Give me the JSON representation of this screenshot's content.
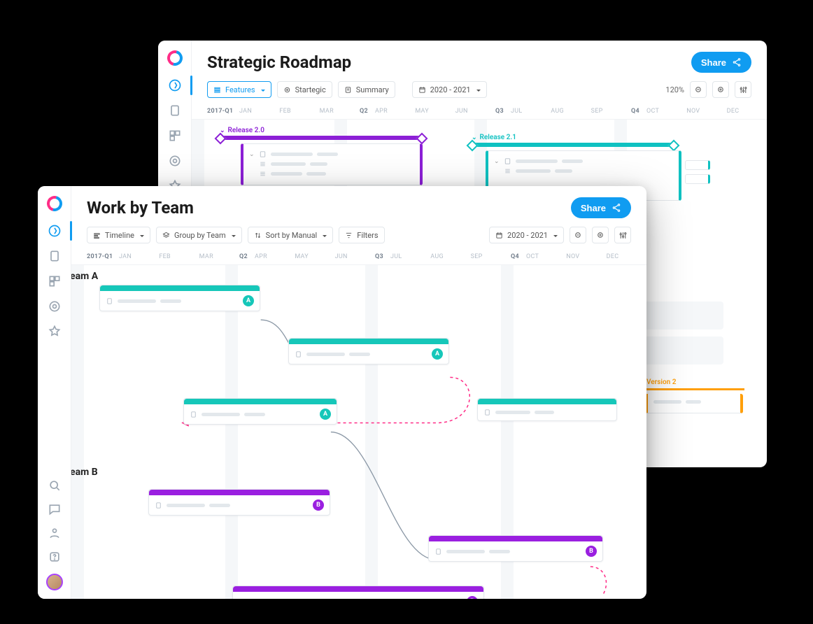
{
  "share_label": "Share",
  "back": {
    "title": "Strategic Roadmap",
    "toolbar": {
      "features": "Features",
      "strategic": "Startegic",
      "summary": "Summary",
      "daterange": "2020 - 2021",
      "zoom": "120%"
    },
    "months": [
      "2017-Q1",
      "JAN",
      "FEB",
      "MAR",
      "Q2",
      "APR",
      "MAY",
      "JUN",
      "Q3",
      "JUL",
      "AUG",
      "SEP",
      "Q4",
      "OCT",
      "NOV",
      "DEC"
    ],
    "releases": {
      "r20": "Release 2.0",
      "r21": "Release 2.1",
      "v2": "Version 2"
    }
  },
  "front": {
    "title": "Work by Team",
    "toolbar": {
      "timeline": "Timeline",
      "groupby": "Group by Team",
      "sortby": "Sort by Manual",
      "filters": "Filters",
      "daterange": "2020 - 2021"
    },
    "months": [
      "2017-Q1",
      "JAN",
      "FEB",
      "MAR",
      "Q2",
      "APR",
      "MAY",
      "JUN",
      "Q3",
      "JUL",
      "AUG",
      "SEP",
      "Q4",
      "OCT",
      "NOV",
      "DEC"
    ],
    "sections": {
      "a": "Team A",
      "b": "Team B"
    },
    "badges": {
      "a": "A",
      "b": "B"
    }
  }
}
